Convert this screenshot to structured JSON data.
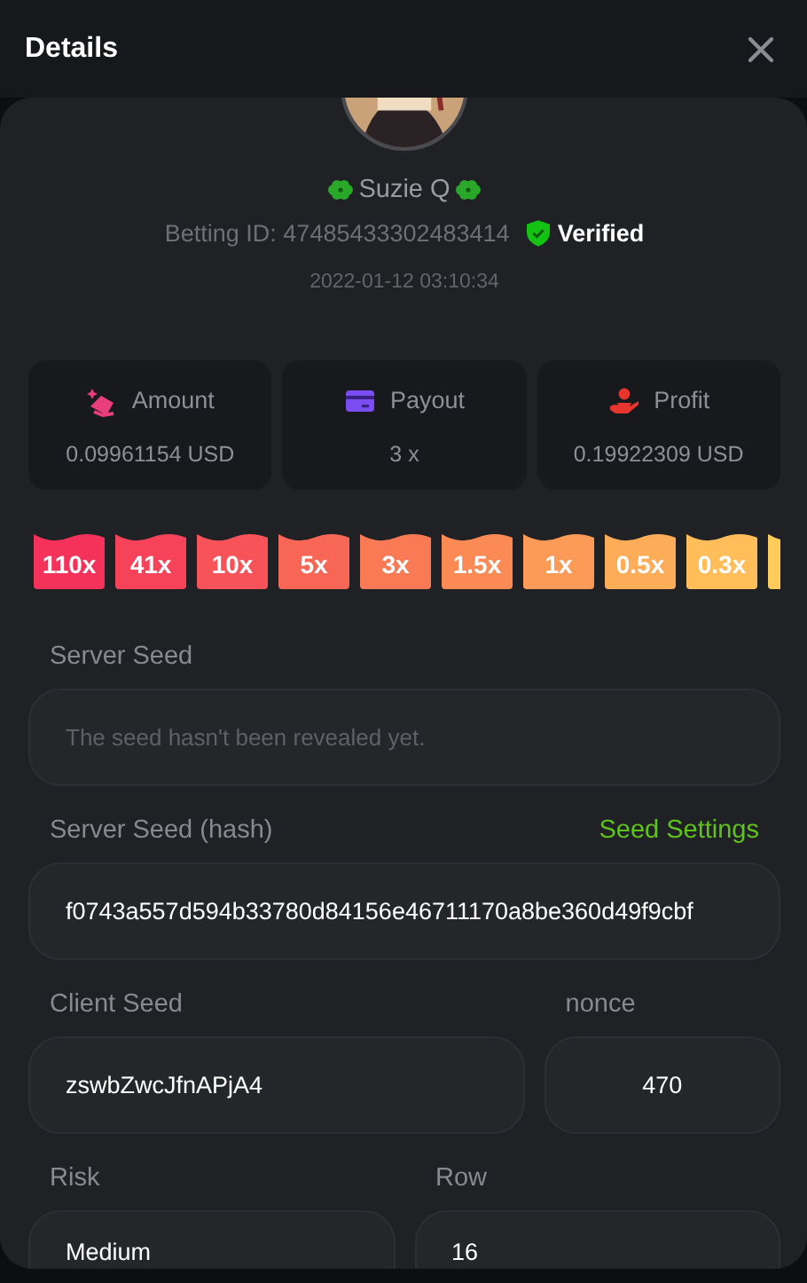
{
  "header": {
    "title": "Details"
  },
  "profile": {
    "name": "Suzie Q",
    "betting_id": "Betting ID: 47485433302483414",
    "verified": "Verified",
    "date": "2022-01-12 03:10:34"
  },
  "stats": [
    {
      "kind": "amount",
      "label": "Amount",
      "value": "0.09961154 USD"
    },
    {
      "kind": "payout",
      "label": "Payout",
      "value": "3 x"
    },
    {
      "kind": "profit",
      "label": "Profit",
      "value": "0.19922309 USD"
    }
  ],
  "multipliers": [
    {
      "label": "110x",
      "color": "#f5325a"
    },
    {
      "label": "41x",
      "color": "#f6435a"
    },
    {
      "label": "10x",
      "color": "#f75358"
    },
    {
      "label": "5x",
      "color": "#f86655"
    },
    {
      "label": "3x",
      "color": "#fa7a55"
    },
    {
      "label": "1.5x",
      "color": "#fb8a55"
    },
    {
      "label": "1x",
      "color": "#fc9b57"
    },
    {
      "label": "0.5x",
      "color": "#fdac58"
    },
    {
      "label": "0.3x",
      "color": "#ffbe59"
    },
    {
      "color": "#ffcc5c"
    }
  ],
  "server_seed": {
    "label": "Server Seed",
    "placeholder": "The seed hasn't been revealed yet."
  },
  "server_seed_hash": {
    "label": "Server Seed (hash)",
    "link": "Seed Settings",
    "value": "f0743a557d594b33780d84156e46711170a8be360d49f9cbf"
  },
  "client_seed": {
    "label": "Client Seed",
    "value": "zswbZwcJfnAPjA4"
  },
  "nonce": {
    "label": "nonce",
    "value": "470"
  },
  "risk": {
    "label": "Risk",
    "value": "Medium"
  },
  "row": {
    "label": "Row",
    "value": "16"
  }
}
